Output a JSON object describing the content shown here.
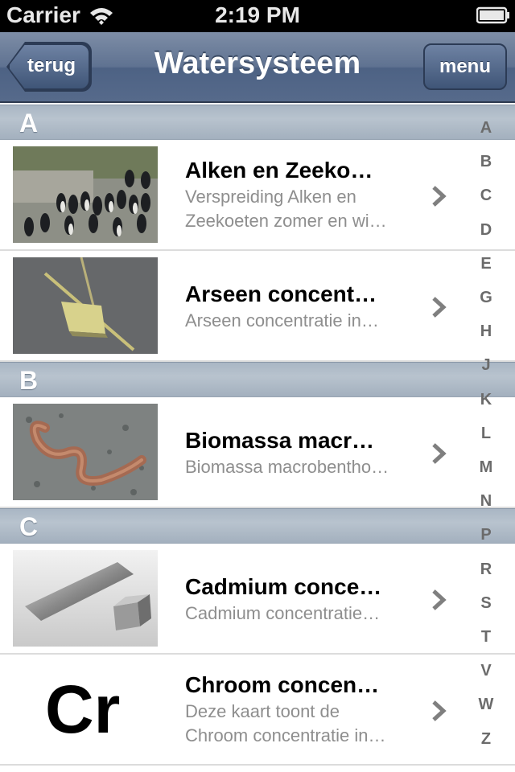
{
  "status_bar": {
    "carrier": "Carrier",
    "time": "2:19 PM"
  },
  "nav": {
    "title": "Watersysteem",
    "back_label": "terug",
    "menu_label": "menu"
  },
  "sections": [
    {
      "letter": "A",
      "items": [
        {
          "title": "Alken en Zeeko…",
          "subtitle_lines": [
            "Verspreiding Alken en",
            "Zeekoeten zomer en wi…"
          ],
          "thumbnail": "birds-photo"
        },
        {
          "title": "Arseen concent…",
          "subtitle_lines": [
            "Arseen concentratie in…"
          ],
          "thumbnail": "sampler-photo"
        }
      ]
    },
    {
      "letter": "B",
      "items": [
        {
          "title": "Biomassa macr…",
          "subtitle_lines": [
            "Biomassa macrobentho…"
          ],
          "thumbnail": "worm-photo"
        }
      ]
    },
    {
      "letter": "C",
      "items": [
        {
          "title": "Cadmium conce…",
          "subtitle_lines": [
            "Cadmium concentratie…"
          ],
          "thumbnail": "cadmium-photo"
        },
        {
          "title": "Chroom concen…",
          "subtitle_lines": [
            "Deze kaart toont de",
            "Chroom concentratie in…"
          ],
          "thumbnail": "cr-symbol",
          "symbol": "Cr"
        }
      ]
    }
  ],
  "index_letters": [
    "A",
    "B",
    "C",
    "D",
    "E",
    "G",
    "H",
    "J",
    "K",
    "L",
    "M",
    "N",
    "P",
    "R",
    "S",
    "T",
    "V",
    "W",
    "Z"
  ],
  "colors": {
    "nav": "#5f7291",
    "section_header": "#b0bcc8",
    "subtitle": "#8e8e8e"
  }
}
